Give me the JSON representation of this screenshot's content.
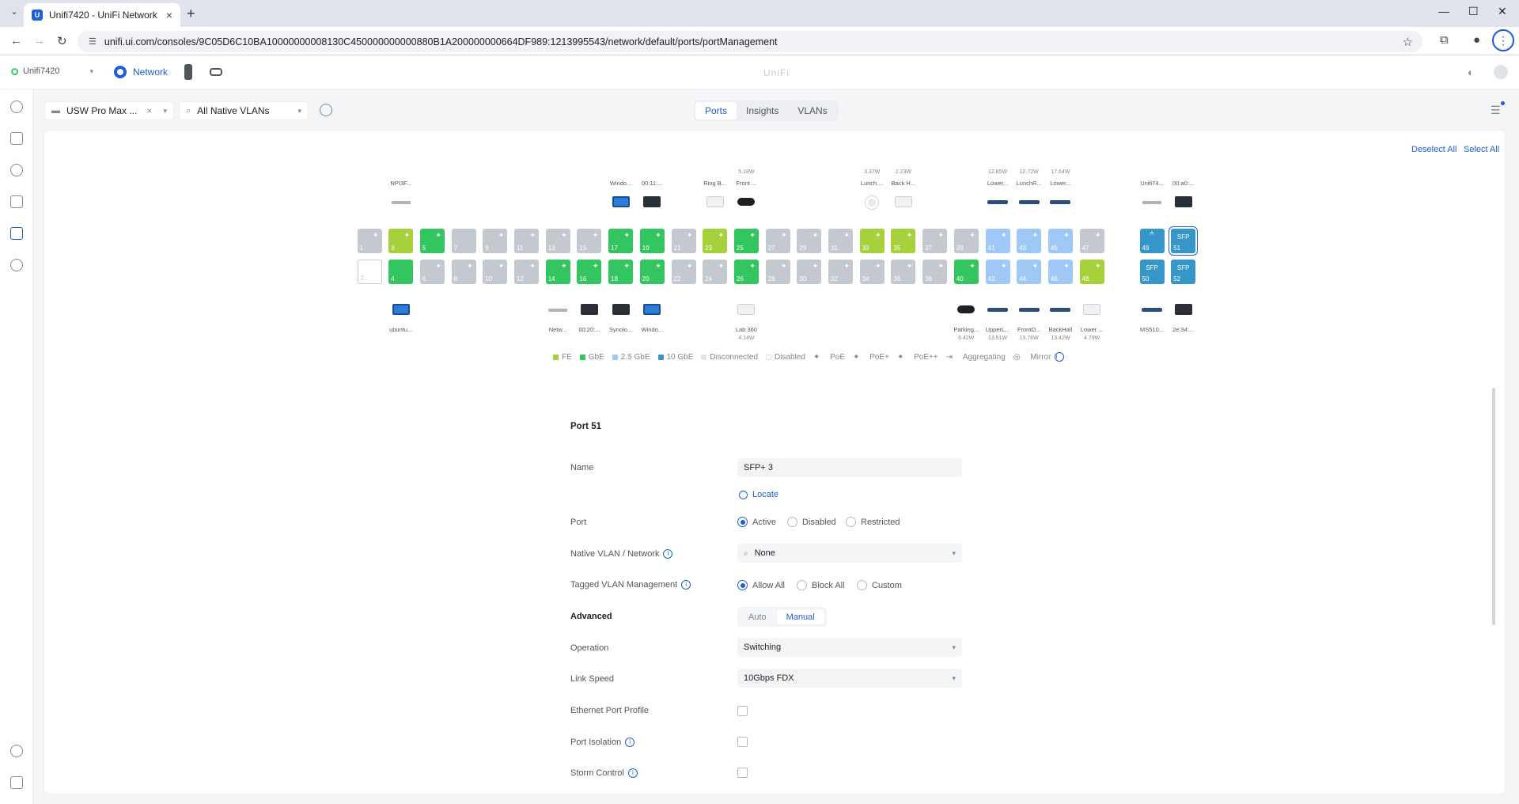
{
  "browser": {
    "tab_title": "Unifi7420 - UniFi Network",
    "url": "unifi.ui.com/consoles/9C05D6C10BA10000000008130C450000000000880B1A200000000664DF989:1213995543/network/default/ports/portManagement"
  },
  "header": {
    "console_name": "Unifi7420",
    "app_name": "Network",
    "logo_text": "UniFi"
  },
  "toolbar": {
    "device_select": "USW Pro Max ...",
    "vlan_filter": "All Native VLANs",
    "tabs": [
      "Ports",
      "Insights",
      "VLANs"
    ],
    "active_tab": "Ports"
  },
  "panel": {
    "deselect_all": "Deselect All",
    "select_all": "Select All"
  },
  "ports_top": [
    {
      "n": "1",
      "cls": "",
      "pe": "✦"
    },
    {
      "n": "3",
      "cls": "fe",
      "pe": "✦",
      "label": "NPI3F...",
      "dev": "grey"
    },
    {
      "n": "5",
      "cls": "gbe",
      "pe": "✦"
    },
    {
      "n": "7",
      "cls": "",
      "pe": ""
    },
    {
      "n": "9",
      "cls": "",
      "pe": "✦"
    },
    {
      "n": "11",
      "cls": "",
      "pe": "✦"
    },
    {
      "n": "13",
      "cls": "",
      "pe": "✦"
    },
    {
      "n": "15",
      "cls": "",
      "pe": "✦"
    },
    {
      "n": "17",
      "cls": "gbe",
      "pe": "✦",
      "label": "Windo...",
      "dev": "blue"
    },
    {
      "n": "19",
      "cls": "gbe",
      "pe": "✦",
      "label": "00:11:...",
      "dev": "dark"
    },
    {
      "n": "21",
      "cls": "",
      "pe": "✦"
    },
    {
      "n": "23",
      "cls": "fe",
      "pe": "✦",
      "label": "Ring B...",
      "dev": "white"
    },
    {
      "n": "25",
      "cls": "gbe",
      "pe": "✦",
      "label": "Front ...",
      "power": "5.18W",
      "dev": "cam"
    },
    {
      "n": "27",
      "cls": "",
      "pe": "✦"
    },
    {
      "n": "29",
      "cls": "",
      "pe": "✦"
    },
    {
      "n": "31",
      "cls": "",
      "pe": "✦"
    },
    {
      "n": "33",
      "cls": "fe",
      "pe": "✦",
      "label": "Lunch ...",
      "power": "3.37W",
      "dev": "dome"
    },
    {
      "n": "35",
      "cls": "fe",
      "pe": "✦",
      "label": "Back H...",
      "power": "2.23W",
      "dev": "white"
    },
    {
      "n": "37",
      "cls": "",
      "pe": "✦"
    },
    {
      "n": "39",
      "cls": "",
      "pe": "✦"
    },
    {
      "n": "41",
      "cls": "g25",
      "pe": "✦",
      "label": "Lower...",
      "power": "12.85W",
      "dev": "flat"
    },
    {
      "n": "43",
      "cls": "g25",
      "pe": "✦",
      "label": "LunchR...",
      "power": "12.72W",
      "dev": "flat"
    },
    {
      "n": "45",
      "cls": "g25",
      "pe": "✦",
      "label": "Lower...",
      "power": "17.64W",
      "dev": "flat"
    },
    {
      "n": "47",
      "cls": "",
      "pe": "✦"
    }
  ],
  "ports_bottom": [
    {
      "n": "2",
      "cls": "off",
      "pe": ""
    },
    {
      "n": "4",
      "cls": "gbe",
      "pe": "",
      "label": "ubuntu...",
      "dev": "blue"
    },
    {
      "n": "6",
      "cls": "",
      "pe": "✦"
    },
    {
      "n": "8",
      "cls": "",
      "pe": "✦"
    },
    {
      "n": "10",
      "cls": "",
      "pe": "✦"
    },
    {
      "n": "12",
      "cls": "",
      "pe": "✦"
    },
    {
      "n": "14",
      "cls": "gbe",
      "pe": "✦",
      "label": "Netw...",
      "dev": "grey"
    },
    {
      "n": "16",
      "cls": "gbe",
      "pe": "✦",
      "label": "00:20:...",
      "dev": "dark"
    },
    {
      "n": "18",
      "cls": "gbe",
      "pe": "✦",
      "label": "Synolo...",
      "dev": "dark"
    },
    {
      "n": "20",
      "cls": "gbe",
      "pe": "✦",
      "label": "Windo...",
      "dev": "blue"
    },
    {
      "n": "22",
      "cls": "",
      "pe": "✦"
    },
    {
      "n": "24",
      "cls": "",
      "pe": "✦"
    },
    {
      "n": "26",
      "cls": "gbe",
      "pe": "✦",
      "label": "Lab 360",
      "power": "4.14W",
      "dev": "white"
    },
    {
      "n": "28",
      "cls": "",
      "pe": "✦"
    },
    {
      "n": "30",
      "cls": "",
      "pe": "✦"
    },
    {
      "n": "32",
      "cls": "",
      "pe": "✦"
    },
    {
      "n": "34",
      "cls": "",
      "pe": "✦"
    },
    {
      "n": "36",
      "cls": "",
      "pe": "✦"
    },
    {
      "n": "38",
      "cls": "",
      "pe": "✦"
    },
    {
      "n": "40",
      "cls": "gbe",
      "pe": "✦",
      "label": "Parking...",
      "power": "6.42W",
      "dev": "cam"
    },
    {
      "n": "42",
      "cls": "g25",
      "pe": "✦",
      "label": "UpperL...",
      "power": "13.51W",
      "dev": "flat"
    },
    {
      "n": "44",
      "cls": "g25",
      "pe": "✦",
      "label": "FrontO...",
      "power": "13.76W",
      "dev": "flat"
    },
    {
      "n": "46",
      "cls": "g25",
      "pe": "✦",
      "label": "BackHall",
      "power": "13.42W",
      "dev": "flat"
    },
    {
      "n": "48",
      "cls": "fe",
      "pe": "✦",
      "label": "Lower ...",
      "power": "4.79W",
      "dev": "white"
    }
  ],
  "sfp_ports": [
    {
      "n": "49",
      "row": "top",
      "cls": "g10",
      "text": "^",
      "label": "Unifi74...",
      "dev": "grey"
    },
    {
      "n": "51",
      "row": "top",
      "cls": "g10 sel",
      "text": "SFP",
      "label": "00:a0:...",
      "dev": "dark"
    },
    {
      "n": "50",
      "row": "bottom",
      "cls": "g10",
      "text": "SFP",
      "label": "MS510...",
      "dev": "flat"
    },
    {
      "n": "52",
      "row": "bottom",
      "cls": "g10",
      "text": "SFP",
      "label": "2e:34:...",
      "dev": "dark"
    }
  ],
  "legend": {
    "items": [
      {
        "label": "FE",
        "color": "#a6d13b"
      },
      {
        "label": "GbE",
        "color": "#33c55f"
      },
      {
        "label": "2.5 GbE",
        "color": "#9fc8f7"
      },
      {
        "label": "10 GbE",
        "color": "#3796c8"
      },
      {
        "label": "Disconnected",
        "color": "#e3e5e8"
      },
      {
        "label": "Disabled",
        "color": "#ffffff"
      }
    ],
    "symbols": [
      "PoE",
      "PoE+",
      "PoE++",
      "Aggregating",
      "Mirror"
    ]
  },
  "form": {
    "title": "Port 51",
    "name_label": "Name",
    "name_value": "SFP+ 3",
    "locate": "Locate",
    "port_label": "Port",
    "port_options": [
      "Active",
      "Disabled",
      "Restricted"
    ],
    "native_vlan_label": "Native VLAN / Network",
    "native_vlan_value": "None",
    "tagged_label": "Tagged VLAN Management",
    "tagged_options": [
      "Allow All",
      "Block All",
      "Custom"
    ],
    "advanced_label": "Advanced",
    "advanced_options": [
      "Auto",
      "Manual"
    ],
    "operation_label": "Operation",
    "operation_value": "Switching",
    "link_speed_label": "Link Speed",
    "link_speed_value": "10Gbps FDX",
    "eth_profile_label": "Ethernet Port Profile",
    "isolation_label": "Port Isolation",
    "storm_label": "Storm Control"
  }
}
